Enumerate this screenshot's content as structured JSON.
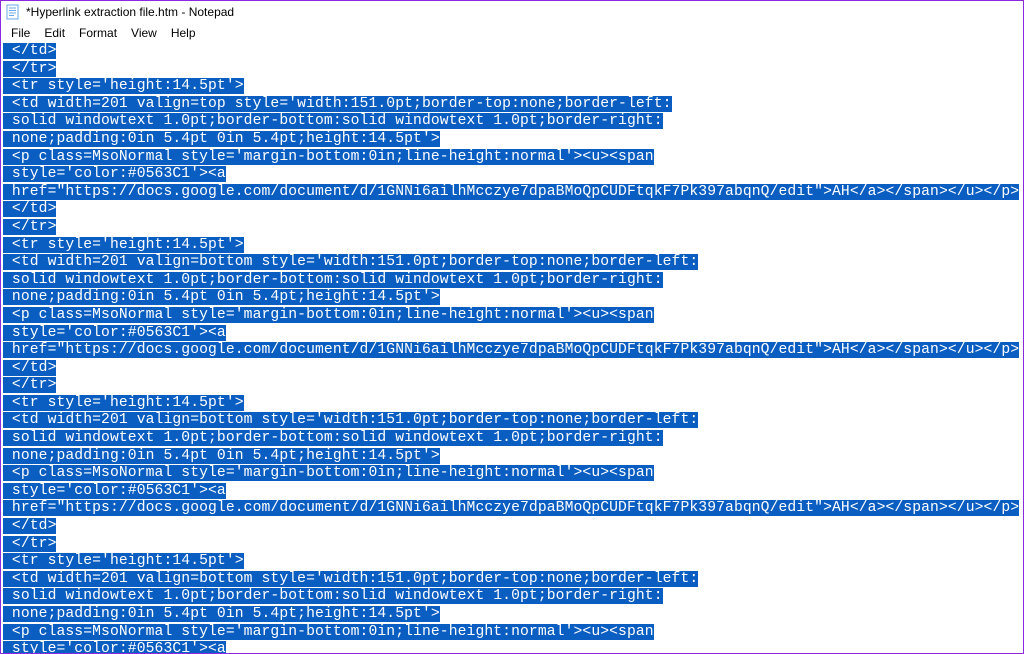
{
  "window": {
    "title": "*Hyperlink extraction file.htm - Notepad"
  },
  "menu": {
    "file": "File",
    "edit": "Edit",
    "format": "Format",
    "view": "View",
    "help": "Help"
  },
  "selection_color": "#0a5ec2",
  "block": {
    "td_open_top": " <td width=201 valign=top style='width:151.0pt;border-top:none;border-left:",
    "td_open_bottom": " <td width=201 valign=bottom style='width:151.0pt;border-top:none;border-left:",
    "border1": " solid windowtext 1.0pt;border-bottom:solid windowtext 1.0pt;border-right:",
    "border2": " none;padding:0in 5.4pt 0in 5.4pt;height:14.5pt'>",
    "p_open": " <p class=MsoNormal style='margin-bottom:0in;line-height:normal'><u><span",
    "span_a": " style='color:#0563C1'><a",
    "href": " href=\"https://docs.google.com/document/d/1GNNi6ailhMcczye7dpaBMoQpCUDFtqkF7Pk397abqnQ/edit\">AH</a></span></u></p>",
    "td_close": " </td>",
    "tr_close": " </tr>",
    "tr_open": " <tr style='height:14.5pt'>"
  },
  "last_partial": " href=\"https://docs.google.com/document/d/1GNNi6ailhMcczye7dpaBMoQpCUDFtqkF7Pk397abqnQ/edit\">AH</a></span></u></p>",
  "lines": [
    {
      "key": "block.td_close"
    },
    {
      "key": "block.tr_close"
    },
    {
      "key": "block.tr_open"
    },
    {
      "key": "block.td_open_top"
    },
    {
      "key": "block.border1"
    },
    {
      "key": "block.border2"
    },
    {
      "key": "block.p_open"
    },
    {
      "key": "block.span_a"
    },
    {
      "key": "block.href"
    },
    {
      "key": "block.td_close"
    },
    {
      "key": "block.tr_close"
    },
    {
      "key": "block.tr_open"
    },
    {
      "key": "block.td_open_bottom"
    },
    {
      "key": "block.border1"
    },
    {
      "key": "block.border2"
    },
    {
      "key": "block.p_open"
    },
    {
      "key": "block.span_a"
    },
    {
      "key": "block.href"
    },
    {
      "key": "block.td_close"
    },
    {
      "key": "block.tr_close"
    },
    {
      "key": "block.tr_open"
    },
    {
      "key": "block.td_open_bottom"
    },
    {
      "key": "block.border1"
    },
    {
      "key": "block.border2"
    },
    {
      "key": "block.p_open"
    },
    {
      "key": "block.span_a"
    },
    {
      "key": "block.href"
    },
    {
      "key": "block.td_close"
    },
    {
      "key": "block.tr_close"
    },
    {
      "key": "block.tr_open"
    },
    {
      "key": "block.td_open_bottom"
    },
    {
      "key": "block.border1"
    },
    {
      "key": "block.border2"
    },
    {
      "key": "block.p_open"
    },
    {
      "key": "block.span_a"
    }
  ]
}
